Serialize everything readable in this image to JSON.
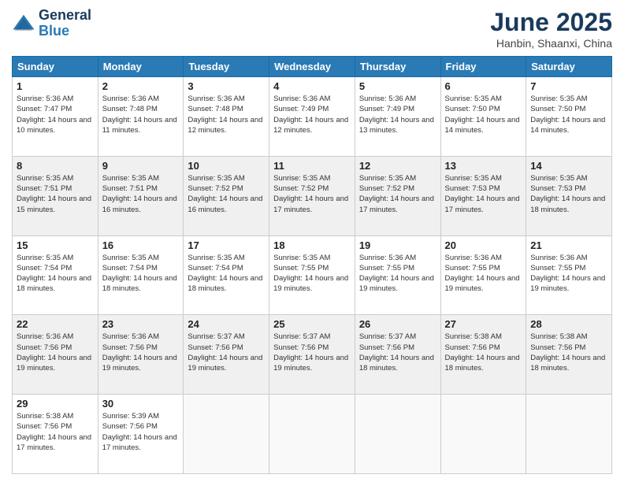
{
  "logo": {
    "general": "General",
    "blue": "Blue"
  },
  "title": {
    "month": "June 2025",
    "location": "Hanbin, Shaanxi, China"
  },
  "headers": [
    "Sunday",
    "Monday",
    "Tuesday",
    "Wednesday",
    "Thursday",
    "Friday",
    "Saturday"
  ],
  "weeks": [
    [
      {
        "day": "1",
        "sunrise": "5:36 AM",
        "sunset": "7:47 PM",
        "daylight": "14 hours and 10 minutes."
      },
      {
        "day": "2",
        "sunrise": "5:36 AM",
        "sunset": "7:48 PM",
        "daylight": "14 hours and 11 minutes."
      },
      {
        "day": "3",
        "sunrise": "5:36 AM",
        "sunset": "7:48 PM",
        "daylight": "14 hours and 12 minutes."
      },
      {
        "day": "4",
        "sunrise": "5:36 AM",
        "sunset": "7:49 PM",
        "daylight": "14 hours and 12 minutes."
      },
      {
        "day": "5",
        "sunrise": "5:36 AM",
        "sunset": "7:49 PM",
        "daylight": "14 hours and 13 minutes."
      },
      {
        "day": "6",
        "sunrise": "5:35 AM",
        "sunset": "7:50 PM",
        "daylight": "14 hours and 14 minutes."
      },
      {
        "day": "7",
        "sunrise": "5:35 AM",
        "sunset": "7:50 PM",
        "daylight": "14 hours and 14 minutes."
      }
    ],
    [
      {
        "day": "8",
        "sunrise": "5:35 AM",
        "sunset": "7:51 PM",
        "daylight": "14 hours and 15 minutes."
      },
      {
        "day": "9",
        "sunrise": "5:35 AM",
        "sunset": "7:51 PM",
        "daylight": "14 hours and 16 minutes."
      },
      {
        "day": "10",
        "sunrise": "5:35 AM",
        "sunset": "7:52 PM",
        "daylight": "14 hours and 16 minutes."
      },
      {
        "day": "11",
        "sunrise": "5:35 AM",
        "sunset": "7:52 PM",
        "daylight": "14 hours and 17 minutes."
      },
      {
        "day": "12",
        "sunrise": "5:35 AM",
        "sunset": "7:52 PM",
        "daylight": "14 hours and 17 minutes."
      },
      {
        "day": "13",
        "sunrise": "5:35 AM",
        "sunset": "7:53 PM",
        "daylight": "14 hours and 17 minutes."
      },
      {
        "day": "14",
        "sunrise": "5:35 AM",
        "sunset": "7:53 PM",
        "daylight": "14 hours and 18 minutes."
      }
    ],
    [
      {
        "day": "15",
        "sunrise": "5:35 AM",
        "sunset": "7:54 PM",
        "daylight": "14 hours and 18 minutes."
      },
      {
        "day": "16",
        "sunrise": "5:35 AM",
        "sunset": "7:54 PM",
        "daylight": "14 hours and 18 minutes."
      },
      {
        "day": "17",
        "sunrise": "5:35 AM",
        "sunset": "7:54 PM",
        "daylight": "14 hours and 18 minutes."
      },
      {
        "day": "18",
        "sunrise": "5:35 AM",
        "sunset": "7:55 PM",
        "daylight": "14 hours and 19 minutes."
      },
      {
        "day": "19",
        "sunrise": "5:36 AM",
        "sunset": "7:55 PM",
        "daylight": "14 hours and 19 minutes."
      },
      {
        "day": "20",
        "sunrise": "5:36 AM",
        "sunset": "7:55 PM",
        "daylight": "14 hours and 19 minutes."
      },
      {
        "day": "21",
        "sunrise": "5:36 AM",
        "sunset": "7:55 PM",
        "daylight": "14 hours and 19 minutes."
      }
    ],
    [
      {
        "day": "22",
        "sunrise": "5:36 AM",
        "sunset": "7:56 PM",
        "daylight": "14 hours and 19 minutes."
      },
      {
        "day": "23",
        "sunrise": "5:36 AM",
        "sunset": "7:56 PM",
        "daylight": "14 hours and 19 minutes."
      },
      {
        "day": "24",
        "sunrise": "5:37 AM",
        "sunset": "7:56 PM",
        "daylight": "14 hours and 19 minutes."
      },
      {
        "day": "25",
        "sunrise": "5:37 AM",
        "sunset": "7:56 PM",
        "daylight": "14 hours and 19 minutes."
      },
      {
        "day": "26",
        "sunrise": "5:37 AM",
        "sunset": "7:56 PM",
        "daylight": "14 hours and 18 minutes."
      },
      {
        "day": "27",
        "sunrise": "5:38 AM",
        "sunset": "7:56 PM",
        "daylight": "14 hours and 18 minutes."
      },
      {
        "day": "28",
        "sunrise": "5:38 AM",
        "sunset": "7:56 PM",
        "daylight": "14 hours and 18 minutes."
      }
    ],
    [
      {
        "day": "29",
        "sunrise": "5:38 AM",
        "sunset": "7:56 PM",
        "daylight": "14 hours and 17 minutes."
      },
      {
        "day": "30",
        "sunrise": "5:39 AM",
        "sunset": "7:56 PM",
        "daylight": "14 hours and 17 minutes."
      },
      null,
      null,
      null,
      null,
      null
    ]
  ]
}
